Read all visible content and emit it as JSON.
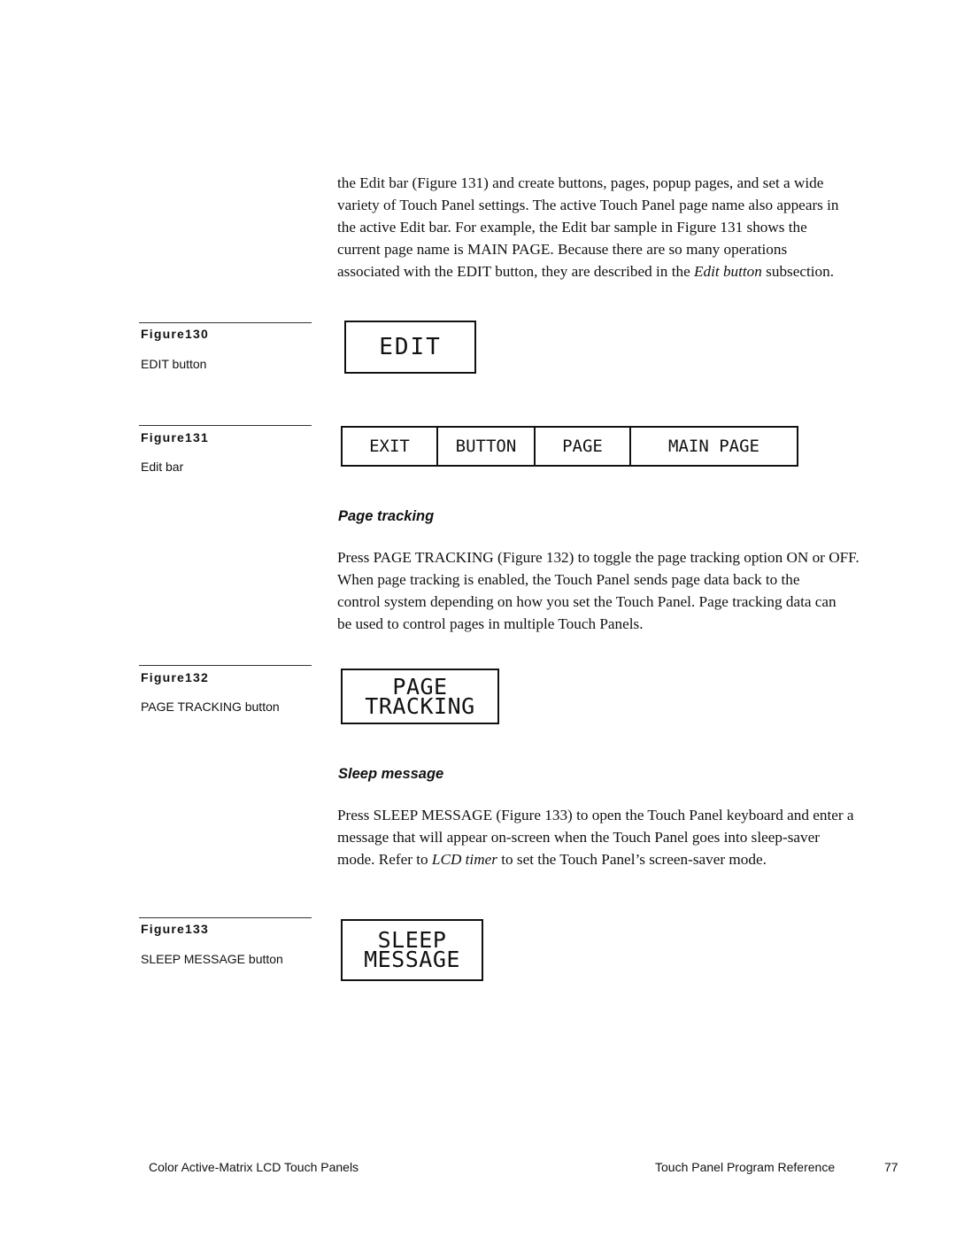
{
  "intro_paragraph": {
    "lines": [
      "the Edit bar (Figure 131) and create buttons, pages, popup pages, and set a wide",
      "variety of Touch Panel settings. The active Touch Panel page name also appears in",
      "the active Edit bar. For example, the Edit bar sample in Figure 131 shows the",
      "current page name is MAIN PAGE. Because there are so many operations"
    ],
    "last_line_before": "associated with the EDIT button, they are described in the ",
    "last_line_italic": "Edit button",
    "last_line_after": " subsection."
  },
  "figures": [
    {
      "number": "Figure130",
      "caption": "EDIT button"
    },
    {
      "number": "Figure131",
      "caption": "Edit bar"
    },
    {
      "number": "Figure132",
      "caption": "PAGE TRACKING button"
    },
    {
      "number": "Figure133",
      "caption": "SLEEP MESSAGE button"
    }
  ],
  "edit_button": {
    "label": "EDIT"
  },
  "edit_bar": {
    "cells": [
      "EXIT",
      "BUTTON",
      "PAGE",
      "MAIN PAGE"
    ]
  },
  "page_tracking": {
    "heading": "Page tracking",
    "lines": [
      "Press PAGE TRACKING (Figure 132) to toggle the page tracking option ON or OFF.",
      "When page tracking is enabled, the Touch Panel sends page data back to the",
      "control system depending on how you set the Touch Panel. Page tracking data can",
      "be used to control pages in multiple Touch Panels."
    ],
    "button_lines": [
      "PAGE",
      "TRACKING"
    ]
  },
  "sleep_message": {
    "heading": "Sleep message",
    "lines": [
      "Press SLEEP MESSAGE (Figure 133) to open the Touch Panel keyboard and enter a",
      "message that will appear on-screen when the Touch Panel goes into sleep-saver"
    ],
    "last_line_before": "mode. Refer to ",
    "last_line_italic": "LCD timer",
    "last_line_after": " to set the Touch Panel’s screen-saver mode.",
    "button_lines": [
      "SLEEP",
      "MESSAGE"
    ]
  },
  "footer": {
    "left": "Color Active-Matrix LCD Touch Panels",
    "section": "Touch Panel Program Reference",
    "page_number": "77"
  }
}
